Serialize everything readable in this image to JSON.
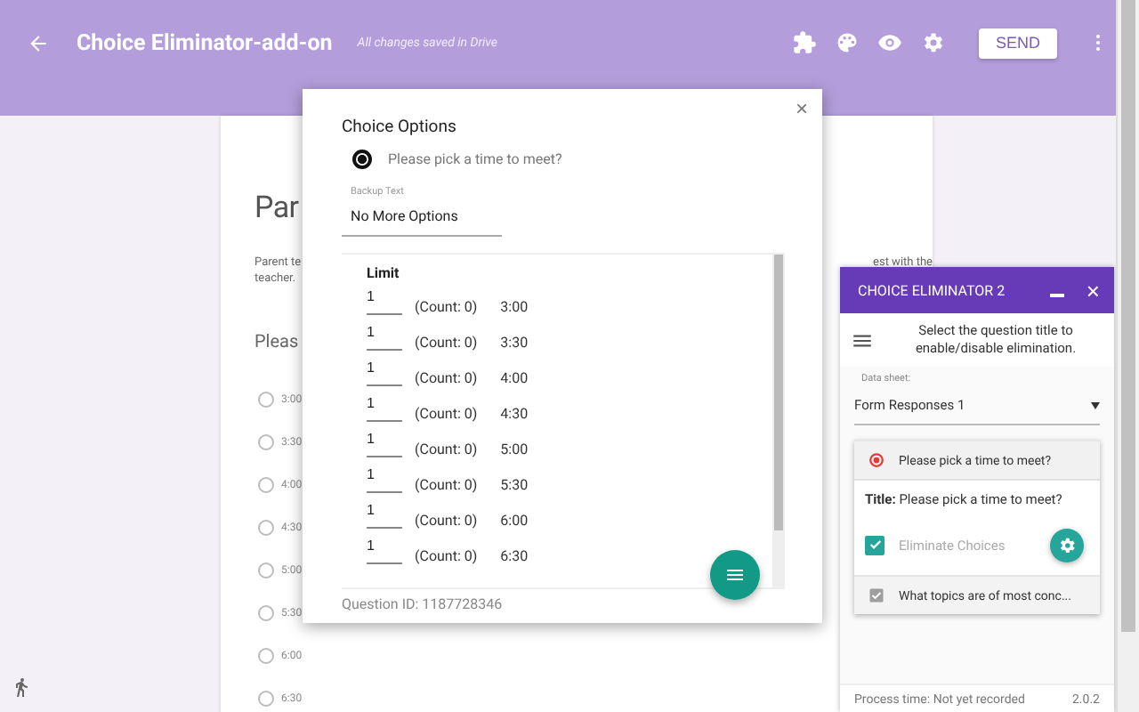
{
  "header": {
    "title": "Choice Eliminator-add-on",
    "status": "All changes saved in Drive",
    "send": "SEND"
  },
  "form": {
    "title": "Par",
    "description_lines": [
      "Parent te",
      "teacher."
    ],
    "description_right": "est with the",
    "question": "Pleas",
    "options": [
      {
        "label": "3:00",
        "selected": false
      },
      {
        "label": "3:30",
        "selected": false
      },
      {
        "label": "4:00",
        "selected": false
      },
      {
        "label": "4:30",
        "selected": false
      },
      {
        "label": "5:00",
        "selected": false
      },
      {
        "label": "5:30",
        "selected": false
      },
      {
        "label": "6:00",
        "selected": false
      },
      {
        "label": "6:30",
        "selected": false
      }
    ]
  },
  "modal": {
    "title": "Choice Options",
    "close": "×",
    "question": {
      "label": "Please pick a time to meet?",
      "selected": true
    },
    "backup_label": "Backup Text",
    "backup_value": "No More Options",
    "limit_heading": "Limit",
    "rows": [
      {
        "limit": "1",
        "count": "(Count: 0)",
        "label": "3:00"
      },
      {
        "limit": "1",
        "count": "(Count: 0)",
        "label": "3:30"
      },
      {
        "limit": "1",
        "count": "(Count: 0)",
        "label": "4:00"
      },
      {
        "limit": "1",
        "count": "(Count: 0)",
        "label": "4:30"
      },
      {
        "limit": "1",
        "count": "(Count: 0)",
        "label": "5:00"
      },
      {
        "limit": "1",
        "count": "(Count: 0)",
        "label": "5:30"
      },
      {
        "limit": "1",
        "count": "(Count: 0)",
        "label": "6:00"
      },
      {
        "limit": "1",
        "count": "(Count: 0)",
        "label": "6:30"
      }
    ],
    "question_id": "Question ID: 1187728346"
  },
  "sidebar": {
    "title": "CHOICE ELIMINATOR 2",
    "close": "×",
    "instructions": "Select the question title to enable/disable elimination.",
    "sheet_label": "Data sheet:",
    "sheet_value": "Form Responses 1",
    "questions": [
      {
        "kind": "radio",
        "title": "Please pick a time to meet?",
        "expanded": true,
        "detail": "**Title:** Please pick a time to meet?",
        "eliminate_label": "Eliminate Choices",
        "eliminate": true
      },
      {
        "kind": "checkbox",
        "title": "What topics are of most conc...",
        "expanded": false
      }
    ],
    "process_time": "Process time: Not yet recorded",
    "version": "2.0.2"
  }
}
